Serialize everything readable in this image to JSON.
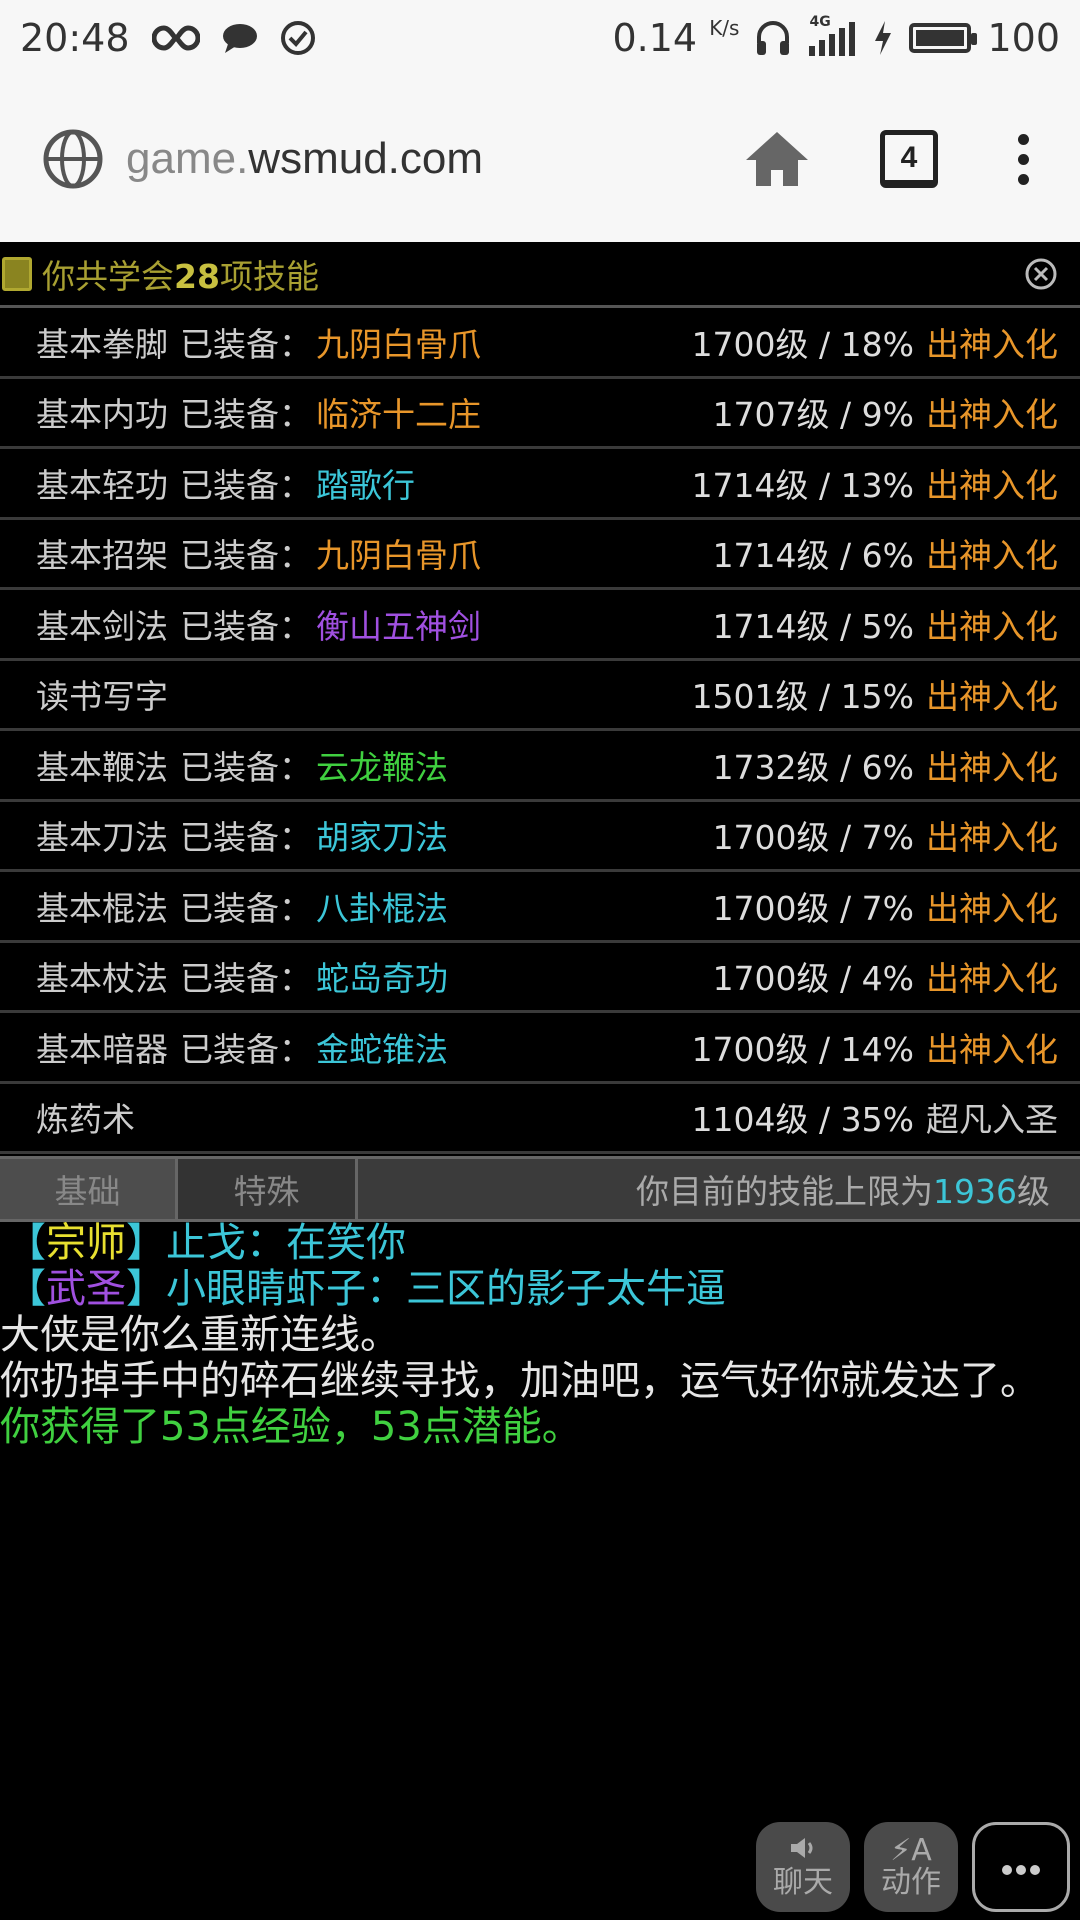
{
  "status_bar": {
    "time": "20:48",
    "speed": "0.14",
    "speed_unit": "K/s",
    "network": "4G",
    "battery": "100",
    "battery_level": 1.0
  },
  "browser": {
    "url_prefix": "game.",
    "url_main": "wsmud.com",
    "tab_count": "4"
  },
  "skills_panel": {
    "title_pre": "你共学会",
    "title_count": "28",
    "title_post": "项技能",
    "equip_label": "已装备：",
    "rows": [
      {
        "name": "基本拳脚",
        "equipped": "九阴白骨爪",
        "equip_color": "#e8962a",
        "level": "1700级 / 18%",
        "rank": "出神入化",
        "rank_color": "#e8962a"
      },
      {
        "name": "基本内功",
        "equipped": "临济十二庄",
        "equip_color": "#e8962a",
        "level": "1707级 / 9%",
        "rank": "出神入化",
        "rank_color": "#e8962a"
      },
      {
        "name": "基本轻功",
        "equipped": "踏歌行",
        "equip_color": "#3cc6d8",
        "level": "1714级 / 13%",
        "rank": "出神入化",
        "rank_color": "#e8962a"
      },
      {
        "name": "基本招架",
        "equipped": "九阴白骨爪",
        "equip_color": "#e8962a",
        "level": "1714级 / 6%",
        "rank": "出神入化",
        "rank_color": "#e8962a"
      },
      {
        "name": "基本剑法",
        "equipped": "衡山五神剑",
        "equip_color": "#a050e0",
        "level": "1714级 / 5%",
        "rank": "出神入化",
        "rank_color": "#e8962a"
      },
      {
        "name": "读书写字",
        "equipped": "",
        "equip_color": "#ccc",
        "level": "1501级 / 15%",
        "rank": "出神入化",
        "rank_color": "#e8962a"
      },
      {
        "name": "基本鞭法",
        "equipped": "云龙鞭法",
        "equip_color": "#40d040",
        "level": "1732级 / 6%",
        "rank": "出神入化",
        "rank_color": "#e8962a"
      },
      {
        "name": "基本刀法",
        "equipped": "胡家刀法",
        "equip_color": "#3cc6d8",
        "level": "1700级 / 7%",
        "rank": "出神入化",
        "rank_color": "#e8962a"
      },
      {
        "name": "基本棍法",
        "equipped": "八卦棍法",
        "equip_color": "#3cc6d8",
        "level": "1700级 / 7%",
        "rank": "出神入化",
        "rank_color": "#e8962a"
      },
      {
        "name": "基本杖法",
        "equipped": "蛇岛奇功",
        "equip_color": "#3cc6d8",
        "level": "1700级 / 4%",
        "rank": "出神入化",
        "rank_color": "#e8962a"
      },
      {
        "name": "基本暗器",
        "equipped": "金蛇锥法",
        "equip_color": "#3cc6d8",
        "level": "1700级 / 14%",
        "rank": "出神入化",
        "rank_color": "#e8962a"
      },
      {
        "name": "炼药术",
        "equipped": "",
        "equip_color": "#ccc",
        "level": "1104级 / 35%",
        "rank": "超凡入圣",
        "rank_color": "#cccccc"
      }
    ]
  },
  "tabs": {
    "basic": "基础",
    "special": "特殊",
    "limit_pre": "你目前的技能上限为",
    "limit_value": "1936",
    "limit_post": "级"
  },
  "log": [
    {
      "segments": [
        {
          "text": "【",
          "color": "#3cc6d8"
        },
        {
          "text": "宗师",
          "color": "#e8e030"
        },
        {
          "text": "】止戈：在笑你",
          "color": "#3cc6d8"
        }
      ],
      "indent": true
    },
    {
      "segments": [
        {
          "text": "【",
          "color": "#3cc6d8"
        },
        {
          "text": "武圣",
          "color": "#a050e0"
        },
        {
          "text": "】小眼睛虾子：三区的影子太牛逼",
          "color": "#3cc6d8"
        }
      ],
      "indent": true
    },
    {
      "segments": [
        {
          "text": "大侠是你么重新连线。",
          "color": "#e6e6e6"
        }
      ],
      "indent": false
    },
    {
      "segments": [
        {
          "text": "你扔掉手中的碎石继续寻找，加油吧，运气好你就发达了。",
          "color": "#e6e6e6"
        }
      ],
      "indent": false,
      "wrap": true
    },
    {
      "segments": [
        {
          "text": "你获得了53点经验，53点潜能。",
          "color": "#40d040"
        }
      ],
      "indent": false
    }
  ],
  "buttons": {
    "chat": "聊天",
    "action": "动作",
    "action_glyph": "⚡A"
  }
}
